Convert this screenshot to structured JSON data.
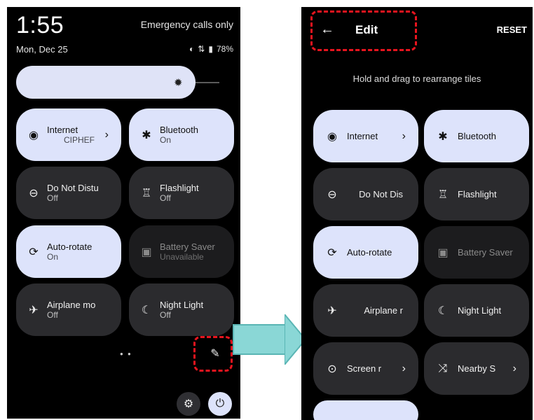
{
  "left": {
    "time": "1:55",
    "carrier_status": "Emergency calls only",
    "date": "Mon, Dec 25",
    "battery": "78%",
    "tiles": [
      {
        "name": "Internet",
        "sub": "CIPHEF",
        "icon": "wifi-icon",
        "glyph": "◉",
        "state": "on",
        "chevron": true
      },
      {
        "name": "Bluetooth",
        "sub": "On",
        "icon": "bluetooth-icon",
        "glyph": "✱",
        "state": "on"
      },
      {
        "name": "Do Not Distu",
        "sub": "Off",
        "icon": "do-not-disturb-icon",
        "glyph": "⊖",
        "state": "off"
      },
      {
        "name": "Flashlight",
        "sub": "Off",
        "icon": "flashlight-icon",
        "glyph": "♖",
        "state": "off"
      },
      {
        "name": "Auto-rotate",
        "sub": "On",
        "icon": "auto-rotate-icon",
        "glyph": "⟳",
        "state": "on"
      },
      {
        "name": "Battery Saver",
        "sub": "Unavailable",
        "icon": "battery-saver-icon",
        "glyph": "▣",
        "state": "dis"
      },
      {
        "name": "Airplane mo",
        "sub": "Off",
        "icon": "airplane-icon",
        "glyph": "✈",
        "state": "off"
      },
      {
        "name": "Night Light",
        "sub": "Off",
        "icon": "night-light-icon",
        "glyph": "☾",
        "state": "off"
      }
    ]
  },
  "right": {
    "title": "Edit",
    "reset_label": "RESET",
    "hint": "Hold and drag to rearrange tiles",
    "tiles": [
      {
        "name": "Internet",
        "icon": "wifi-icon",
        "glyph": "◉",
        "state": "on",
        "chevron": true
      },
      {
        "name": "Bluetooth",
        "icon": "bluetooth-icon",
        "glyph": "✱",
        "state": "on"
      },
      {
        "name": "Do Not Dis",
        "icon": "do-not-disturb-icon",
        "glyph": "⊖",
        "state": "off"
      },
      {
        "name": "Flashlight",
        "icon": "flashlight-icon",
        "glyph": "♖",
        "state": "off"
      },
      {
        "name": "Auto-rotate",
        "icon": "auto-rotate-icon",
        "glyph": "⟳",
        "state": "on"
      },
      {
        "name": "Battery Saver",
        "icon": "battery-saver-icon",
        "glyph": "▣",
        "state": "dis"
      },
      {
        "name": "Airplane r",
        "icon": "airplane-icon",
        "glyph": "✈",
        "state": "off"
      },
      {
        "name": "Night Light",
        "icon": "night-light-icon",
        "glyph": "☾",
        "state": "off"
      },
      {
        "name": "Screen r",
        "icon": "screen-record-icon",
        "glyph": "⊙",
        "state": "off",
        "chevron": true
      },
      {
        "name": "Nearby S",
        "icon": "nearby-share-icon",
        "glyph": "⤨",
        "state": "off",
        "chevron": true
      }
    ]
  },
  "colors": {
    "highlight": "#e8141e",
    "arrow": "#8ad7d6",
    "tile_on": "#dde3fb",
    "tile_off": "#2b2b2e"
  }
}
